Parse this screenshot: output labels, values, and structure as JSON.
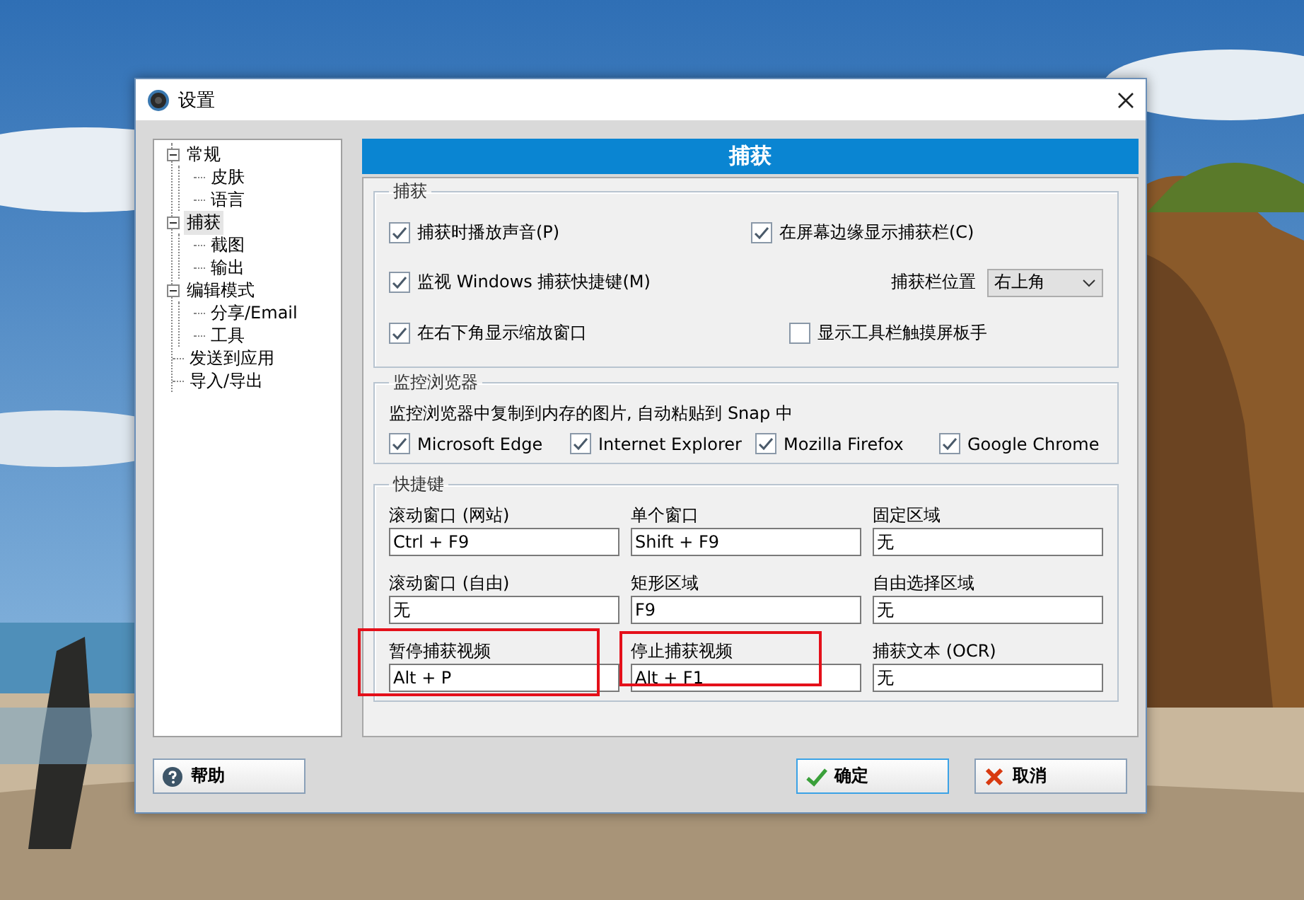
{
  "window": {
    "title": "设置"
  },
  "sidebar": {
    "items": [
      {
        "label": "常规",
        "selected": false,
        "expanded": true,
        "children": [
          {
            "label": "皮肤",
            "selected": false
          },
          {
            "label": "语言",
            "selected": false
          }
        ]
      },
      {
        "label": "捕获",
        "selected": true,
        "expanded": true,
        "children": [
          {
            "label": "截图",
            "selected": false
          },
          {
            "label": "输出",
            "selected": false
          }
        ]
      },
      {
        "label": "编辑模式",
        "selected": false,
        "expanded": true,
        "children": [
          {
            "label": "分享/Email",
            "selected": false
          },
          {
            "label": "工具",
            "selected": false
          }
        ]
      },
      {
        "label": "发送到应用",
        "selected": false
      },
      {
        "label": "导入/导出",
        "selected": false
      }
    ]
  },
  "header": "捕获",
  "capture_group": {
    "title": "捕获",
    "options": [
      {
        "label": "捕获时播放声音(P)",
        "checked": true
      },
      {
        "label": "在屏幕边缘显示捕获栏(C)",
        "checked": true
      },
      {
        "label": "监视 Windows 捕获快捷键(M)",
        "checked": true
      },
      {
        "label": "在右下角显示缩放窗口",
        "checked": true
      },
      {
        "label": "显示工具栏触摸屏板手",
        "checked": false
      }
    ],
    "position": {
      "label": "捕获栏位置",
      "value": "右上角"
    }
  },
  "browser_group": {
    "title": "监控浏览器",
    "description": "监控浏览器中复制到内存的图片, 自动粘贴到 Snap 中",
    "browsers": [
      {
        "label": "Microsoft Edge",
        "checked": true
      },
      {
        "label": "Internet Explorer",
        "checked": true
      },
      {
        "label": "Mozilla Firefox",
        "checked": true
      },
      {
        "label": "Google Chrome",
        "checked": true
      }
    ]
  },
  "hotkey_group": {
    "title": "快捷键",
    "hotkeys": [
      {
        "label": "滚动窗口 (网站)",
        "value": "Ctrl + F9",
        "highlighted": false
      },
      {
        "label": "单个窗口",
        "value": "Shift + F9",
        "highlighted": false
      },
      {
        "label": "固定区域",
        "value": "无",
        "highlighted": false
      },
      {
        "label": "滚动窗口 (自由)",
        "value": "无",
        "highlighted": false
      },
      {
        "label": "矩形区域",
        "value": "F9",
        "highlighted": false
      },
      {
        "label": "自由选择区域",
        "value": "无",
        "highlighted": false
      },
      {
        "label": "暂停捕获视频",
        "value": "Alt + P",
        "highlighted": true
      },
      {
        "label": "停止捕获视频",
        "value": "Alt + F1",
        "highlighted": true
      },
      {
        "label": "捕获文本 (OCR)",
        "value": "无",
        "highlighted": false
      }
    ]
  },
  "buttons": [
    {
      "kind": "help",
      "label": "帮助"
    },
    {
      "kind": "ok",
      "label": "确定"
    },
    {
      "kind": "cancel",
      "label": "取消"
    }
  ]
}
